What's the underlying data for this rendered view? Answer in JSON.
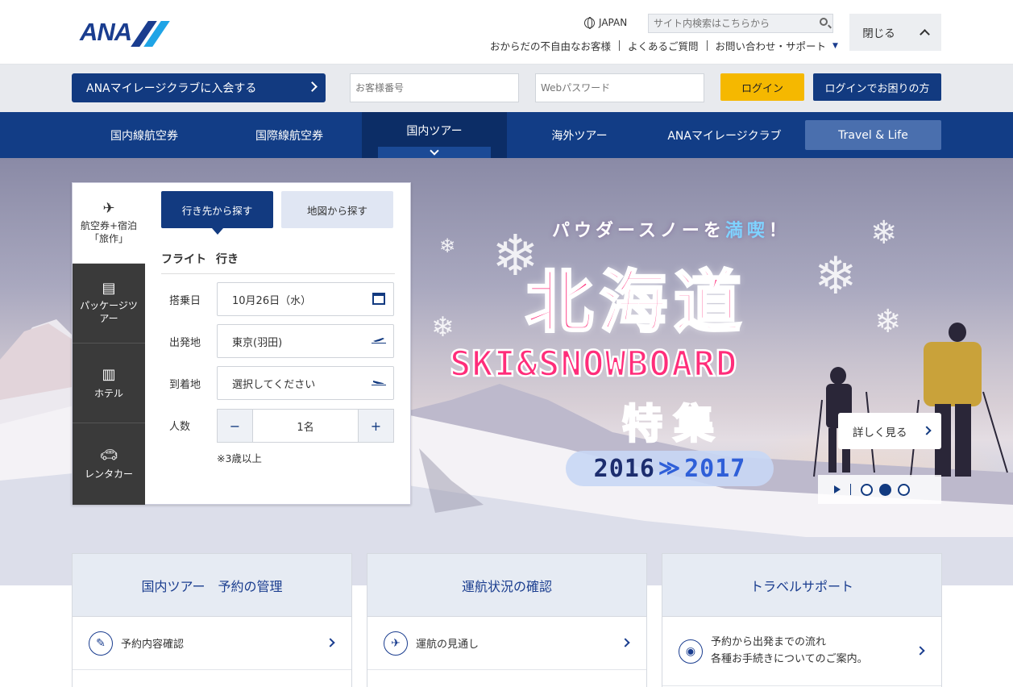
{
  "header": {
    "logo_text": "ANA",
    "language": "JAPAN",
    "search_placeholder": "サイト内検索はこちらから",
    "links": [
      "おからだの不自由なお客様",
      "よくあるご質問",
      "お問い合わせ・サポート"
    ],
    "close_label": "閉じる"
  },
  "login": {
    "join_label": "ANAマイレージクラブに入会する",
    "customer_number_placeholder": "お客様番号",
    "password_placeholder": "Webパスワード",
    "login_label": "ログイン",
    "help_label": "ログインでお困りの方"
  },
  "nav": {
    "items": [
      "国内線航空券",
      "国際線航空券",
      "国内ツアー",
      "海外ツアー",
      "ANAマイレージクラブ",
      "Travel & Life"
    ]
  },
  "hero": {
    "sub": "パウダースノーを",
    "sub_highlight": "満喫",
    "sub_end": "！",
    "main": "北海道",
    "english": "SKI&SNOWBOARD",
    "tokushu": "特集",
    "year_from": "2016",
    "year_arrow": "≫",
    "year_to": "2017",
    "detail_label": "詳しく見る"
  },
  "search_panel": {
    "side_tabs": [
      {
        "label": "航空券+宿泊「旅作」",
        "icon": "plane-hotel-icon"
      },
      {
        "label": "パッケージツアー",
        "icon": "package-icon"
      },
      {
        "label": "ホテル",
        "icon": "hotel-icon"
      },
      {
        "label": "レンタカー",
        "icon": "car-icon"
      }
    ],
    "sub_tabs": [
      "行き先から探す",
      "地図から探す"
    ],
    "flight_title": "フライト",
    "flight_direction": "行き",
    "fields": {
      "date_label": "搭乗日",
      "date_value": "10月26日（水）",
      "from_label": "出発地",
      "from_value": "東京(羽田)",
      "to_label": "到着地",
      "to_value": "選択してください",
      "people_label": "人数",
      "people_value": "1名",
      "minus": "−",
      "plus": "+"
    },
    "note": "※3歳以上"
  },
  "cards": [
    {
      "title": "国内ツアー　予約の管理",
      "row": "予約内容確認",
      "icon": "edit-icon"
    },
    {
      "title": "運航状況の確認",
      "row": "運航の見通し",
      "icon": "airplane-icon"
    },
    {
      "title": "トラベルサポート",
      "row_line1": "予約から出発までの流れ",
      "row_line2": "各種お手続きについてのご案内。",
      "icon": "mouse-icon"
    }
  ]
}
